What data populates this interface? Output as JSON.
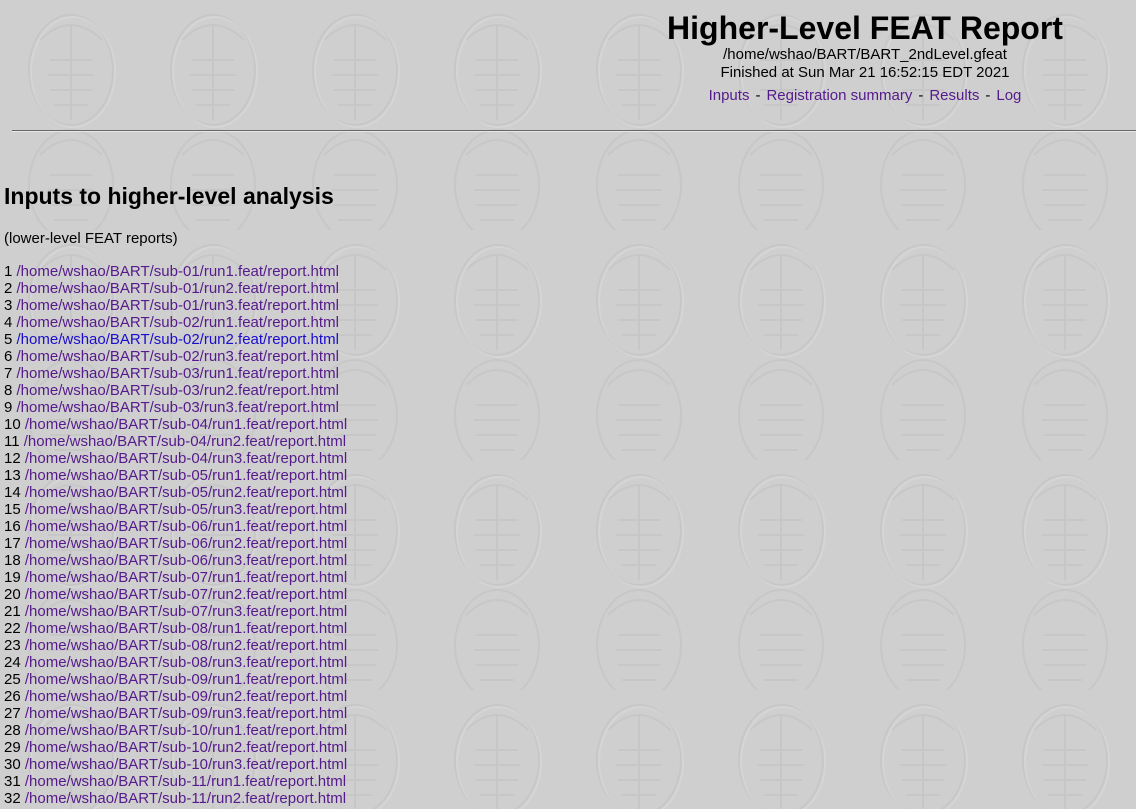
{
  "header": {
    "title": "Higher-Level FEAT Report",
    "path": "/home/wshao/BART/BART_2ndLevel.gfeat",
    "finished": "Finished at Sun Mar 21 16:52:15 EDT 2021",
    "nav": [
      {
        "label": "Inputs"
      },
      {
        "label": "Registration summary"
      },
      {
        "label": "Results"
      },
      {
        "label": "Log"
      }
    ],
    "separator": "-"
  },
  "section": {
    "title": "Inputs to higher-level analysis",
    "note": "(lower-level FEAT reports)"
  },
  "inputs": [
    {
      "index": "1",
      "path": "/home/wshao/BART/sub-01/run1.feat/report.html"
    },
    {
      "index": "2",
      "path": "/home/wshao/BART/sub-01/run2.feat/report.html"
    },
    {
      "index": "3",
      "path": "/home/wshao/BART/sub-01/run3.feat/report.html"
    },
    {
      "index": "4",
      "path": "/home/wshao/BART/sub-02/run1.feat/report.html"
    },
    {
      "index": "5",
      "path": "/home/wshao/BART/sub-02/run2.feat/report.html",
      "active": true
    },
    {
      "index": "6",
      "path": "/home/wshao/BART/sub-02/run3.feat/report.html"
    },
    {
      "index": "7",
      "path": "/home/wshao/BART/sub-03/run1.feat/report.html"
    },
    {
      "index": "8",
      "path": "/home/wshao/BART/sub-03/run2.feat/report.html"
    },
    {
      "index": "9",
      "path": "/home/wshao/BART/sub-03/run3.feat/report.html"
    },
    {
      "index": "10",
      "path": "/home/wshao/BART/sub-04/run1.feat/report.html"
    },
    {
      "index": "11",
      "path": "/home/wshao/BART/sub-04/run2.feat/report.html"
    },
    {
      "index": "12",
      "path": "/home/wshao/BART/sub-04/run3.feat/report.html"
    },
    {
      "index": "13",
      "path": "/home/wshao/BART/sub-05/run1.feat/report.html"
    },
    {
      "index": "14",
      "path": "/home/wshao/BART/sub-05/run2.feat/report.html"
    },
    {
      "index": "15",
      "path": "/home/wshao/BART/sub-05/run3.feat/report.html"
    },
    {
      "index": "16",
      "path": "/home/wshao/BART/sub-06/run1.feat/report.html"
    },
    {
      "index": "17",
      "path": "/home/wshao/BART/sub-06/run2.feat/report.html"
    },
    {
      "index": "18",
      "path": "/home/wshao/BART/sub-06/run3.feat/report.html"
    },
    {
      "index": "19",
      "path": "/home/wshao/BART/sub-07/run1.feat/report.html"
    },
    {
      "index": "20",
      "path": "/home/wshao/BART/sub-07/run2.feat/report.html"
    },
    {
      "index": "21",
      "path": "/home/wshao/BART/sub-07/run3.feat/report.html"
    },
    {
      "index": "22",
      "path": "/home/wshao/BART/sub-08/run1.feat/report.html"
    },
    {
      "index": "23",
      "path": "/home/wshao/BART/sub-08/run2.feat/report.html"
    },
    {
      "index": "24",
      "path": "/home/wshao/BART/sub-08/run3.feat/report.html"
    },
    {
      "index": "25",
      "path": "/home/wshao/BART/sub-09/run1.feat/report.html"
    },
    {
      "index": "26",
      "path": "/home/wshao/BART/sub-09/run2.feat/report.html"
    },
    {
      "index": "27",
      "path": "/home/wshao/BART/sub-09/run3.feat/report.html"
    },
    {
      "index": "28",
      "path": "/home/wshao/BART/sub-10/run1.feat/report.html"
    },
    {
      "index": "29",
      "path": "/home/wshao/BART/sub-10/run2.feat/report.html"
    },
    {
      "index": "30",
      "path": "/home/wshao/BART/sub-10/run3.feat/report.html"
    },
    {
      "index": "31",
      "path": "/home/wshao/BART/sub-11/run1.feat/report.html"
    },
    {
      "index": "32",
      "path": "/home/wshao/BART/sub-11/run2.feat/report.html"
    }
  ],
  "colors": {
    "background": "#cfcfcf",
    "link": "#551a8b",
    "active_link": "#1a0dcc"
  }
}
